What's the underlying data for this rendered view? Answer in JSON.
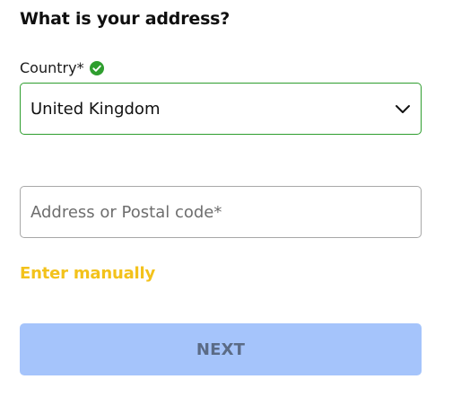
{
  "form": {
    "title": "What is your address?",
    "country": {
      "label": "Country*",
      "status_icon": "check-circle-icon",
      "selected_value": "United Kingdom",
      "dropdown_icon": "chevron-down-icon"
    },
    "address": {
      "value": "",
      "placeholder": "Address or Postal code*"
    },
    "enter_manually_link": "Enter manually",
    "next_button": {
      "label": "NEXT",
      "disabled": true
    }
  },
  "colors": {
    "valid_green": "#2f9e2f",
    "link_yellow": "#f3c21b",
    "button_disabled_bg": "#a5c4fb",
    "button_disabled_text": "#5b6b86"
  }
}
